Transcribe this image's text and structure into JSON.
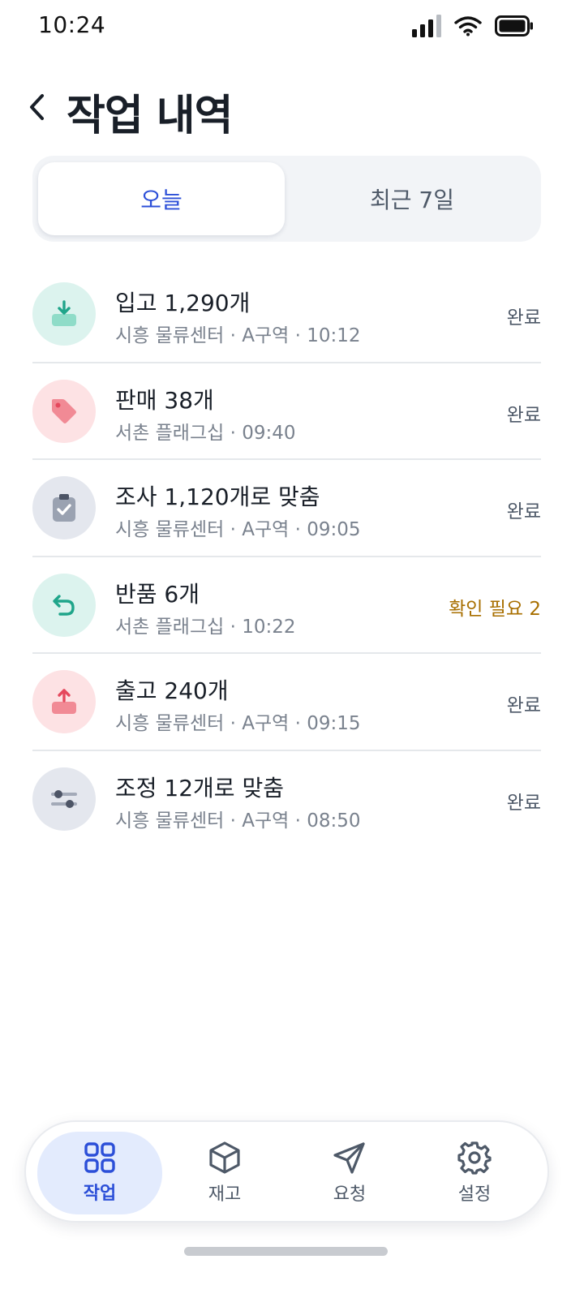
{
  "status_bar": {
    "time": "10:24"
  },
  "header": {
    "title": "작업 내역"
  },
  "segment": {
    "tabs": [
      {
        "label": "오늘",
        "active": true
      },
      {
        "label": "최근 7일",
        "active": false
      }
    ]
  },
  "activities": [
    {
      "icon": "inbound-box-icon",
      "title": "입고 1,290개",
      "subtitle": "시흥 물류센터 · A구역 · 10:12",
      "status": "완료"
    },
    {
      "icon": "price-tag-icon",
      "title": "판매 38개",
      "subtitle": "서촌 플래그십 · 09:40",
      "status": "완료"
    },
    {
      "icon": "clipboard-check-icon",
      "title": "조사 1,120개로 맞춤",
      "subtitle": "시흥 물류센터 · A구역 · 09:05",
      "status": "완료"
    },
    {
      "icon": "return-arrow-icon",
      "title": "반품 6개",
      "subtitle": "서촌 플래그십 · 10:22",
      "status": "확인 필요 2"
    },
    {
      "icon": "outbound-box-icon",
      "title": "출고 240개",
      "subtitle": "시흥 물류센터 · A구역 · 09:15",
      "status": "완료"
    },
    {
      "icon": "sliders-icon",
      "title": "조정 12개로 맞춤",
      "subtitle": "시흥 물류센터 · A구역 · 08:50",
      "status": "완료"
    }
  ],
  "bottom_nav": {
    "items": [
      {
        "label": "작업",
        "icon": "grid-icon",
        "active": true
      },
      {
        "label": "재고",
        "icon": "cube-icon",
        "active": false
      },
      {
        "label": "요청",
        "icon": "send-icon",
        "active": false
      },
      {
        "label": "설정",
        "icon": "gear-icon",
        "active": false
      }
    ]
  },
  "colors": {
    "accent": "#2c4fd8",
    "warning": "#a86f00",
    "mint": "#1fa58a",
    "red": "#e5485d",
    "slate": "#5b6474"
  }
}
